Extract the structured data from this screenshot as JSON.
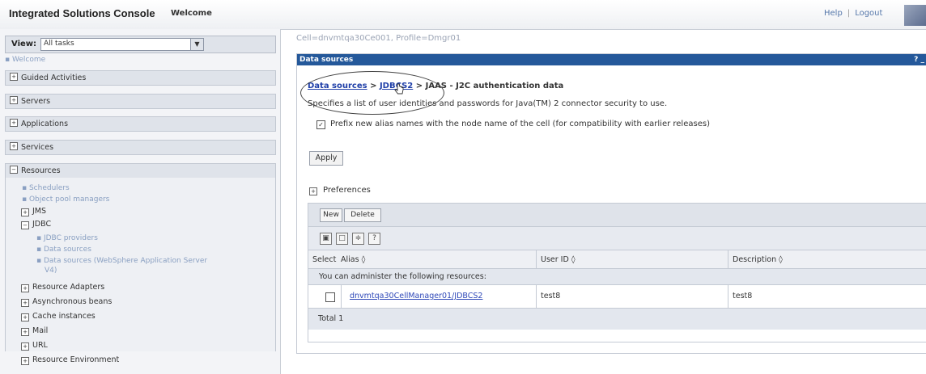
{
  "header": {
    "app_title": "Integrated Solutions Console",
    "welcome": "Welcome",
    "help_link": "Help",
    "separator": "|",
    "logout_link": "Logout"
  },
  "nav": {
    "view_label": "View:",
    "view_value": "All tasks",
    "welcome_link": "Welcome",
    "sections": [
      "Guided Activities",
      "Servers",
      "Applications",
      "Services",
      "Resources"
    ],
    "resources_children": {
      "schedulers": "Schedulers",
      "object_pool_managers": "Object pool managers",
      "jms": "JMS",
      "jdbc": "JDBC",
      "jdbc_providers": "JDBC providers",
      "data_sources": "Data sources",
      "data_sources_was_line1": "Data sources (WebSphere Application Server",
      "data_sources_was_line2": "V4)",
      "resource_adapters": "Resource Adapters",
      "asynchronous_beans": "Asynchronous beans",
      "cache_instances": "Cache instances",
      "mail": "Mail",
      "url": "URL",
      "resource_environment": "Resource Environment"
    }
  },
  "main": {
    "cell_line": "Cell=dnvmtqa30Ce001, Profile=Dmgr01",
    "panel_title": "Data sources",
    "panel_help": "? _",
    "breadcrumb": {
      "link1": "Data sources",
      "sep1": " > ",
      "link2": "JDBCS2",
      "sep2": " > ",
      "current": "JAAS - J2C authentication data"
    },
    "description": "Specifies a list of user identities and passwords for Java(TM) 2 connector security to use.",
    "checkbox_label": "Prefix new alias names with the node name of the cell (for compatibility with earlier releases)",
    "apply_button": "Apply",
    "preferences_label": "Preferences",
    "new_button": "New",
    "delete_button": "Delete",
    "table": {
      "headers": [
        "Select",
        "Alias",
        "User ID",
        "Description"
      ],
      "info": "You can administer the following resources:",
      "rows": [
        {
          "alias": "dnvmtqa30CellManager01/JDBCS2",
          "user_id": "test8",
          "description": "test8"
        }
      ],
      "total": "Total 1"
    }
  }
}
